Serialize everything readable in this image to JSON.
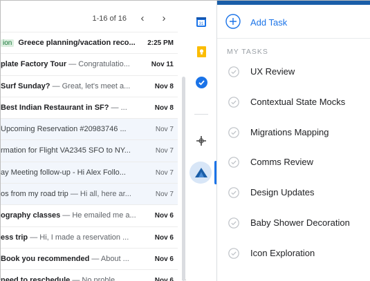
{
  "pager": {
    "range": "1-16 of 16",
    "prev_icon": "chevron-left-icon",
    "next_icon": "chevron-right-icon"
  },
  "emails": [
    {
      "tag": "ion",
      "subject": "Greece planning/vacation reco...",
      "snippet": "",
      "date": "2:25 PM",
      "read": false
    },
    {
      "tag": "",
      "subject": "plate Factory Tour",
      "snippet": " — Congratulatio...",
      "date": "Nov 11",
      "read": false
    },
    {
      "tag": "",
      "subject": "Surf Sunday?",
      "snippet": " — Great, let's meet a...",
      "date": "Nov 8",
      "read": false
    },
    {
      "tag": "",
      "subject": "Best Indian Restaurant in SF?",
      "snippet": " — ...",
      "date": "Nov 8",
      "read": false
    },
    {
      "tag": "",
      "subject": "Upcoming Reservation #20983746 ...",
      "snippet": "",
      "date": "Nov 7",
      "read": true
    },
    {
      "tag": "",
      "subject": "rmation for Flight VA2345 SFO to NY...",
      "snippet": "",
      "date": "Nov 7",
      "read": true
    },
    {
      "tag": "",
      "subject": "ay Meeting follow-up - Hi Alex Follo...",
      "snippet": "",
      "date": "Nov 7",
      "read": true
    },
    {
      "tag": "",
      "subject": "os from my road trip",
      "snippet": " — Hi all, here ar...",
      "date": "Nov 7",
      "read": true
    },
    {
      "tag": "",
      "subject": "ography classes",
      "snippet": " — He emailed me a...",
      "date": "Nov 6",
      "read": false
    },
    {
      "tag": "",
      "subject": "ess trip",
      "snippet": " — Hi, I made a reservation ...",
      "date": "Nov 6",
      "read": false
    },
    {
      "tag": "",
      "subject": "Book you recommended",
      "snippet": " — About ...",
      "date": "Nov 6",
      "read": false
    },
    {
      "tag": "",
      "subject": "need to reschedule",
      "snippet": " — No proble...",
      "date": "Nov 6",
      "read": false
    }
  ],
  "rail": {
    "icons": [
      "calendar-icon",
      "keep-notes-icon",
      "tasks-icon",
      "add-addon-icon",
      "active-addon-icon"
    ]
  },
  "tasks": {
    "add_label": "Add Task",
    "section_title": "MY TASKS",
    "items": [
      "UX Review",
      "Contextual State Mocks",
      "Migrations Mapping",
      "Comms Review",
      "Design Updates",
      "Baby Shower Decoration",
      "Icon Exploration"
    ]
  },
  "colors": {
    "accent": "#1a73e8",
    "topbar": "#1a5ea8",
    "read_row": "#f2f6fc"
  }
}
